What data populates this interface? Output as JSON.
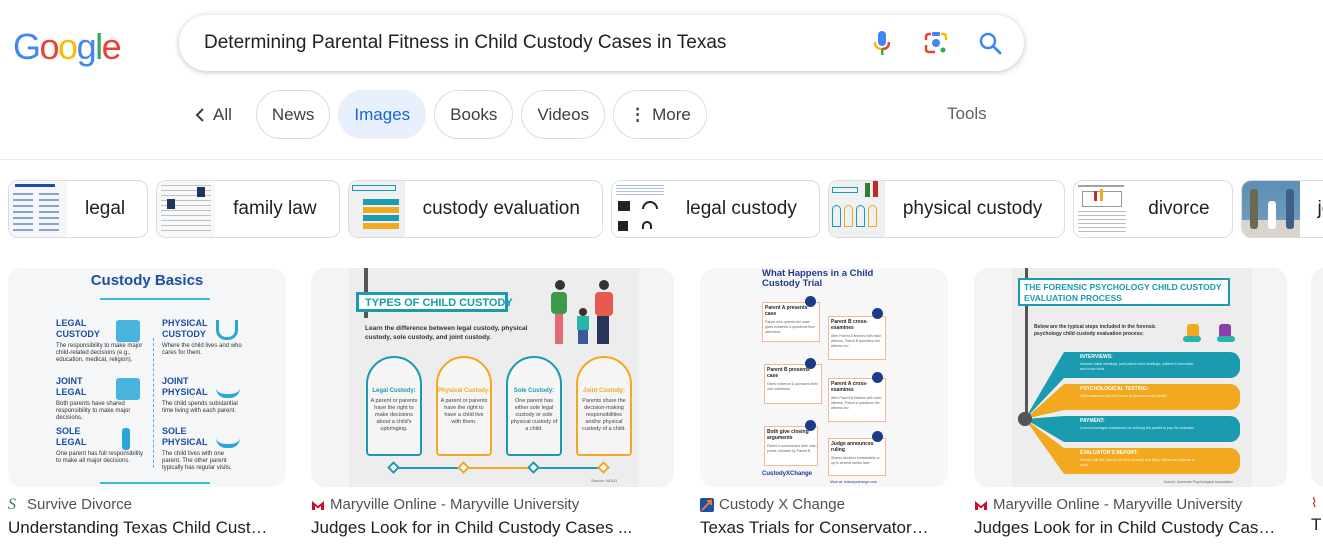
{
  "logo": {
    "letters": [
      {
        "char": "G",
        "color": "#4285f4"
      },
      {
        "char": "o",
        "color": "#ea4335"
      },
      {
        "char": "o",
        "color": "#fbbc05"
      },
      {
        "char": "g",
        "color": "#4285f4"
      },
      {
        "char": "l",
        "color": "#34a853"
      },
      {
        "char": "e",
        "color": "#ea4335"
      }
    ]
  },
  "search": {
    "query": "Determining Parental Fitness in Child Custody Cases in Texas",
    "icons": [
      "microphone-icon",
      "google-lens-icon",
      "search-icon"
    ]
  },
  "tabs": {
    "back_label": "All",
    "items": [
      {
        "label": "News",
        "active": false
      },
      {
        "label": "Images",
        "active": true
      },
      {
        "label": "Books",
        "active": false
      },
      {
        "label": "Videos",
        "active": false
      },
      {
        "label": "More",
        "active": false
      }
    ],
    "tools_label": "Tools"
  },
  "chips": [
    {
      "label": "legal"
    },
    {
      "label": "family law"
    },
    {
      "label": "custody evaluation"
    },
    {
      "label": "legal custody"
    },
    {
      "label": "physical custody"
    },
    {
      "label": "divorce"
    },
    {
      "label": "joint cu"
    }
  ],
  "results": [
    {
      "source": "Survive Divorce",
      "title": "Understanding Texas Child Cust…",
      "image": {
        "heading": "Custody Basics",
        "sections": [
          {
            "title": "LEGAL CUSTODY",
            "text": "The responsibility to make major child-related decisions (e.g., education, medical, religion)."
          },
          {
            "title": "PHYSICAL CUSTODY",
            "text": "Where the child lives and who cares for them."
          },
          {
            "title": "JOINT LEGAL",
            "text": "Both parents have shared responsibility to make major decisions."
          },
          {
            "title": "JOINT PHYSICAL",
            "text": "The child spends substantial time living with each parent."
          },
          {
            "title": "SOLE LEGAL",
            "text": "One parent has full responsibility to make all major decisions."
          },
          {
            "title": "SOLE PHYSICAL",
            "text": "The child lives with one parent. The other parent typically has regular visits."
          }
        ]
      }
    },
    {
      "source": "Maryville Online - Maryville University",
      "title": "Judges Look for in Child Custody Cases ...",
      "image": {
        "heading": "TYPES OF CHILD CUSTODY",
        "subheading": "Learn the difference between legal custody, physical custody, sole custody, and joint custody.",
        "cards": [
          {
            "title": "Legal Custody:",
            "text": "A parent or parents have the right to make decisions about a child's upbringing."
          },
          {
            "title": "Physical Custody:",
            "text": "A parent or parents have the right to have a child live with them."
          },
          {
            "title": "Sole Custody:",
            "text": "One parent has either sole legal custody or sole physical custody of a child."
          },
          {
            "title": "Joint Custody:",
            "text": "Parents share the decision-making responsibilities and/or physical custody of a child."
          }
        ],
        "source_note": "Source: NOLO"
      }
    },
    {
      "source": "Custody X Change",
      "title": "Texas Trials for Conservator…",
      "image": {
        "heading": "What Happens in a Child Custody Trial",
        "steps": [
          {
            "title": "Parent A presents case",
            "text": "Parent who opened the case gives evidence & questions their witnesses"
          },
          {
            "title": "Parent B cross-examines",
            "text": "After Parent A finishes with each witness, Parent B questions the witness too"
          },
          {
            "title": "Parent B presents case",
            "text": "Gives evidence & questions their own witnesses"
          },
          {
            "title": "Parent A cross-examines",
            "text": "After Parent B finishes with each witness, Parent A questions the witness too"
          },
          {
            "title": "Both give closing arguments",
            "text": "Parent A summarizes their main points, followed by Parent B"
          },
          {
            "title": "Judge announces ruling",
            "text": "Shares decision immediately or up to several weeks later"
          }
        ],
        "brand": "CustodyXChange",
        "footer": "More at: custodyxchange.com"
      }
    },
    {
      "source": "Maryville Online - Maryville University",
      "title": "Judges Look for in Child Custody Cas…",
      "image": {
        "heading": "THE FORENSIC PSYCHOLOGY CHILD CUSTODY EVALUATION PROCESS",
        "subheading": "Below are the typical steps included in the forensic psychology child custody evaluation process:",
        "steps": [
          {
            "title": "INTERVIEWS:",
            "text": "Includes initial meetings, joint parent-child meetings, children's interviews, and home visits",
            "color": "#1a9bb0"
          },
          {
            "title": "PSYCHOLOGICAL TESTING:",
            "text": "Helps assess a parent in terms of general mental health",
            "color": "#f2a91f"
          },
          {
            "title": "PAYMENT:",
            "text": "Court encourages compliance by ordering the parties to pay the evaluator",
            "color": "#1a9bb0"
          },
          {
            "title": "EVALUATOR'S REPORT:",
            "text": "Shared with the parents (or their counsel) and likely offered as evidence in court",
            "color": "#f2a91f"
          }
        ],
        "source_note": "Source: American Psychological Association"
      }
    },
    {
      "source": "",
      "title": "T"
    }
  ],
  "colors": {
    "accent_blue": "#1a73e8",
    "active_tab_bg": "#e8f0fe",
    "active_tab_text": "#1967d2",
    "maryville_red": "#c8102e",
    "teal": "#1a9bb0",
    "orange": "#f2a91f",
    "navy": "#1e3a8a"
  }
}
